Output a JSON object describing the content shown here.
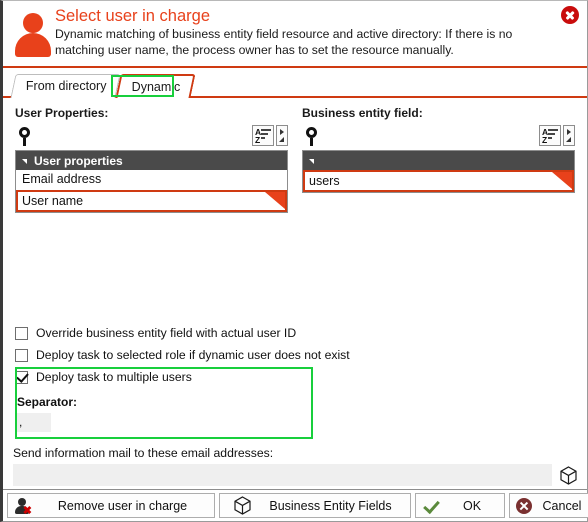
{
  "dialog": {
    "title": "Select user in charge",
    "description": "Dynamic matching of business entity field resource and active directory: If there is no matching user name, the process owner has to set the resource manually.",
    "close_icon": "close-icon"
  },
  "tabs": [
    {
      "label": "From directory",
      "active": false
    },
    {
      "label": "Dynamic",
      "active": true
    }
  ],
  "panels": {
    "left": {
      "label": "User Properties:",
      "search_placeholder": "",
      "search_value": "",
      "group_header": "User properties",
      "rows": [
        {
          "label": "Email address",
          "selected": false
        },
        {
          "label": "User name",
          "selected": true
        }
      ]
    },
    "right": {
      "label": "Business entity field:",
      "search_placeholder": "",
      "search_value": "",
      "group_header": "",
      "rows": [
        {
          "label": "users",
          "selected": true
        }
      ]
    }
  },
  "options": [
    {
      "label": "Override business entity field with actual user ID",
      "checked": false
    },
    {
      "label": "Deploy task to selected role if dynamic user does not exist",
      "checked": false
    },
    {
      "label": "Deploy task to multiple users",
      "checked": true
    }
  ],
  "separator": {
    "label": "Separator:",
    "value": ",",
    "placeholder": ""
  },
  "mail": {
    "label": "Send information mail to these email addresses:",
    "value": "",
    "placeholder": "",
    "picker_icon": "cube-icon"
  },
  "footer": {
    "remove": "Remove user in charge",
    "business_entity_fields": "Business Entity Fields",
    "ok": "OK",
    "cancel": "Cancel"
  },
  "colors": {
    "accent": "#e8411b",
    "rule": "#cf3a12",
    "header_row": "#4a4a4a",
    "highlight": "#18cf3c",
    "close": "#c90c0c",
    "ok_check": "#5b8a3c",
    "cancel": "#7a3030"
  }
}
